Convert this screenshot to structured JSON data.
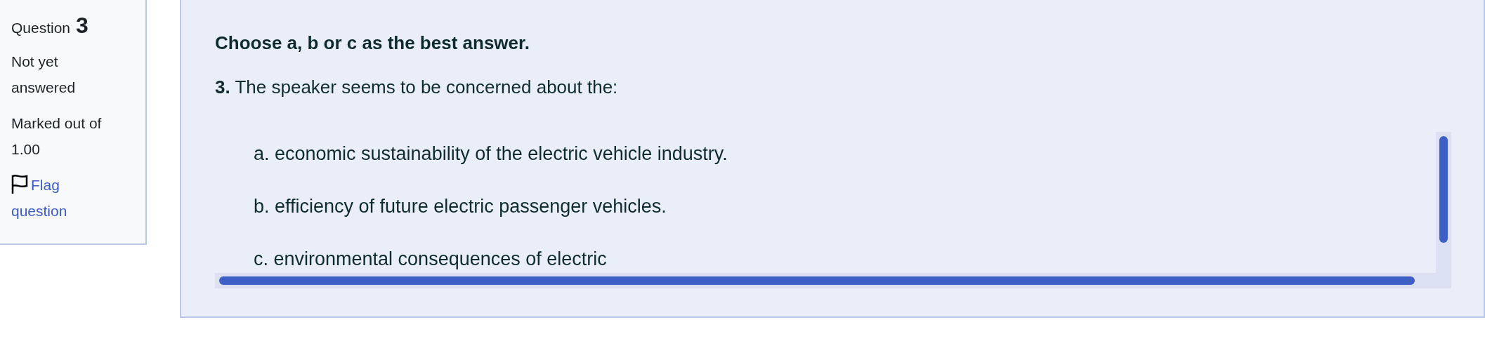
{
  "info": {
    "label": "Question",
    "number": "3",
    "state": "Not yet answered",
    "marks": "Marked out of 1.00",
    "flag": {
      "label": "Flag question",
      "flagged": false
    }
  },
  "question": {
    "instruction": "Choose a, b or c as the best answer.",
    "prompt": "**3.** The speaker seems to be concerned about the:",
    "options": [
      {
        "text": "a. economic sustainability of the electric vehicle industry."
      },
      {
        "text": "b. efficiency of future electric passenger vehicles."
      },
      {
        "text": "c. environmental consequences of electric"
      }
    ]
  }
}
